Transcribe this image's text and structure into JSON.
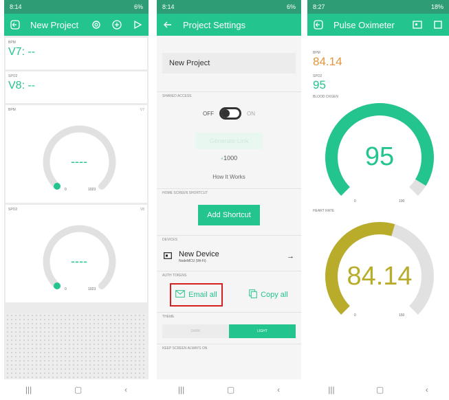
{
  "colors": {
    "accent": "#23c48e",
    "accent_dark": "#2e9d76",
    "olive": "#b8ac2a",
    "orange": "#e3953b",
    "track": "#e1e1e1",
    "highlight": "#d42020"
  },
  "nav": {
    "recent": "|||",
    "home": "▢",
    "back": "‹"
  },
  "phone1": {
    "status": {
      "time": "8:14",
      "right": "6%"
    },
    "app": {
      "title": "New Project"
    },
    "widgets": [
      {
        "label": "BPM",
        "value": "V7: --"
      },
      {
        "label": "SPO2",
        "value": "V8: --"
      }
    ],
    "gauges": [
      {
        "label": "BPM",
        "tag": "V7",
        "value": "----",
        "min": "0",
        "max": "1023",
        "level": 0
      },
      {
        "label": "SPO2",
        "tag": "V8",
        "value": "----",
        "min": "0",
        "max": "1023",
        "level": 0
      }
    ]
  },
  "phone2": {
    "status": {
      "time": "8:14",
      "right": "6%"
    },
    "app": {
      "title": "Project Settings"
    },
    "project_name": "New Project",
    "shared_access": {
      "section": "SHARED ACCESS",
      "off": "OFF",
      "on": "ON"
    },
    "generate_link": "Generate Link",
    "energy": "1000",
    "how_it_works": "How It Works",
    "home_shortcut": {
      "section": "HOME SCREEN SHORTCUT",
      "button": "Add Shortcut"
    },
    "devices": {
      "section": "DEVICES",
      "name": "New Device",
      "sub": "NodeMCU (Wi-Fi)"
    },
    "auth": {
      "section": "AUTH TOKENS",
      "email": "Email all",
      "copy": "Copy all"
    },
    "theme": {
      "section": "THEME",
      "dark": "DARK",
      "light": "LIGHT"
    },
    "keep_screen": "KEEP SCREEN ALWAYS ON"
  },
  "phone3": {
    "status": {
      "time": "8:27",
      "right": "18%"
    },
    "app": {
      "title": "Pulse Oximeter"
    },
    "bpm": {
      "label": "BPM",
      "value": "84.14"
    },
    "spo2": {
      "label": "SPO2",
      "value": "95"
    },
    "blood_gauge": {
      "label": "BLOOD OXGEN",
      "value": "95",
      "min": "0",
      "max": "100",
      "level": 0.95
    },
    "heart_gauge": {
      "label": "HEART RATE",
      "value": "84.14",
      "min": "0",
      "max": "150",
      "level": 0.561
    }
  }
}
